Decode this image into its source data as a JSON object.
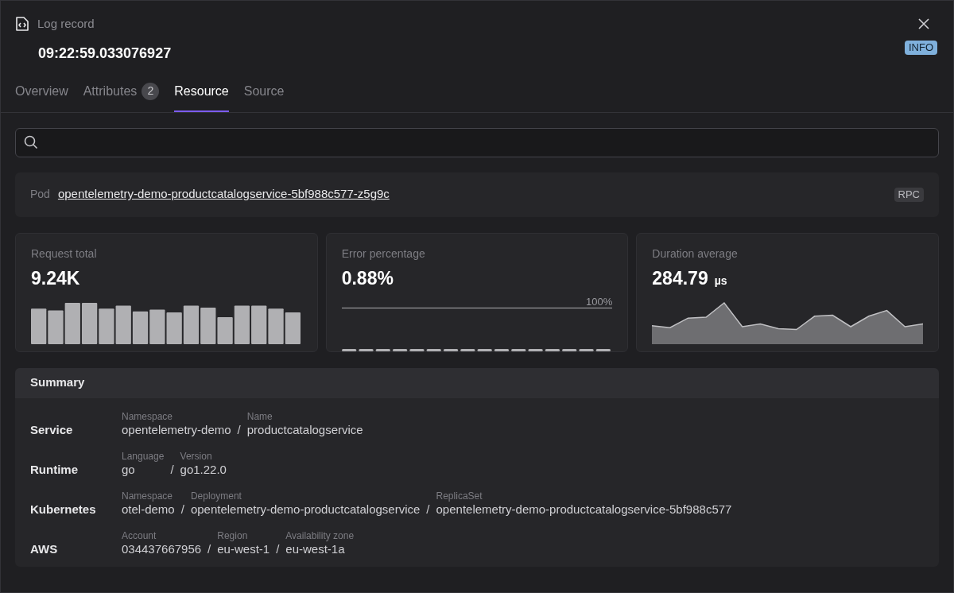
{
  "header": {
    "kind_label": "Log record",
    "timestamp": "09:22:59.033076927",
    "severity": "INFO"
  },
  "tabs": [
    {
      "label": "Overview",
      "selected": false
    },
    {
      "label": "Attributes",
      "count": "2",
      "selected": false
    },
    {
      "label": "Resource",
      "selected": true
    },
    {
      "label": "Source",
      "selected": false
    }
  ],
  "pod": {
    "label": "Pod",
    "value": "opentelemetry-demo-productcatalogservice-5bf988c577-z5g9c",
    "tag": "RPC"
  },
  "metrics": [
    {
      "kind": "bars",
      "title": "Request total",
      "value": "9.24K"
    },
    {
      "kind": "flat",
      "title": "Error percentage",
      "value": "0.88%",
      "max_label": "100%"
    },
    {
      "kind": "area",
      "title": "Duration average",
      "value": "284.79",
      "unit": "µs"
    }
  ],
  "summary": {
    "title": "Summary",
    "separator": "/",
    "rows": [
      {
        "label": "Service",
        "fields": [
          {
            "label": "Namespace",
            "value": "opentelemetry-demo"
          },
          {
            "label": "Name",
            "value": "productcatalogservice"
          }
        ]
      },
      {
        "label": "Runtime",
        "fields": [
          {
            "label": "Language",
            "value": "go"
          },
          {
            "label": "Version",
            "value": "go1.22.0"
          }
        ]
      },
      {
        "label": "Kubernetes",
        "fields": [
          {
            "label": "Namespace",
            "value": "otel-demo"
          },
          {
            "label": "Deployment",
            "value": "opentelemetry-demo-productcatalogservice"
          },
          {
            "label": "ReplicaSet",
            "value": "opentelemetry-demo-productcatalogservice-5bf988c577"
          }
        ]
      },
      {
        "label": "AWS",
        "fields": [
          {
            "label": "Account",
            "value": "034437667956"
          },
          {
            "label": "Region",
            "value": "eu-west-1"
          },
          {
            "label": "Availability zone",
            "value": "eu-west-1a"
          }
        ]
      }
    ]
  }
}
